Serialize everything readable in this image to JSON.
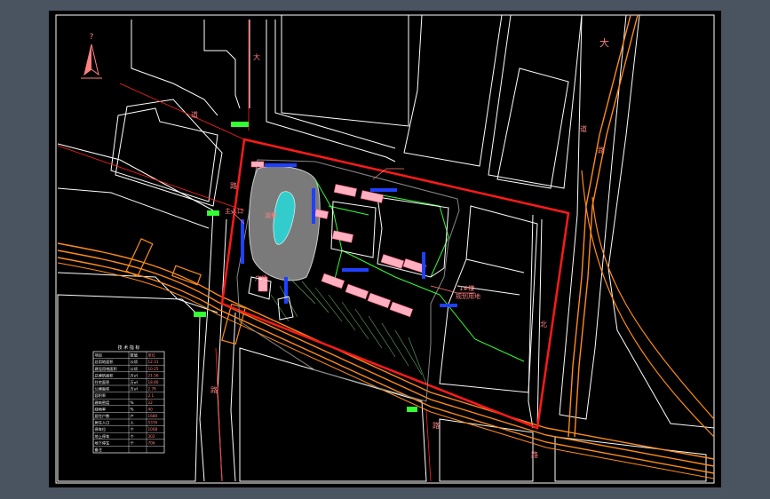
{
  "drawing": {
    "north_mark": "?",
    "road_labels": {
      "top_road": "大",
      "right_road_upper": "道",
      "right_road_lower": "路",
      "vertical_road": "大",
      "site_mid_road": "北",
      "bottom_left": "路",
      "bottom_mid": "路",
      "bottom_right": "路",
      "left_road": "路",
      "left_top": "道"
    },
    "site_labels": {
      "lake_label": "湖景",
      "callout_right_1": "1#楼",
      "callout_right_2": "规划用地",
      "callout_left": "主入口",
      "plaza_label": "广场"
    },
    "legend": {
      "title": "技 术 指 标",
      "header": [
        "项目",
        "数值",
        "单位"
      ],
      "rows": [
        [
          "总用地面积",
          "公顷",
          "12.31"
        ],
        [
          "建设用地面积",
          "公顷",
          "10.25"
        ],
        [
          "总建筑面积",
          "万㎡",
          "21.56"
        ],
        [
          "住宅面积",
          "万㎡",
          "18.80"
        ],
        [
          "公建面积",
          "万㎡",
          "2.76"
        ],
        [
          "容积率",
          "",
          "2.1"
        ],
        [
          "建筑密度",
          "%",
          "22"
        ],
        [
          "绿地率",
          "%",
          "40"
        ],
        [
          "居住户数",
          "户",
          "1680"
        ],
        [
          "居住人口",
          "人",
          "5376"
        ],
        [
          "停车位",
          "个",
          "1008"
        ],
        [
          "地上停车",
          "个",
          "302"
        ],
        [
          "地下停车",
          "个",
          "706"
        ],
        [
          "备注",
          "",
          ""
        ]
      ]
    },
    "colors": {
      "background": "#000000",
      "frame": "#4a5360",
      "boundary": "#ff1a1a",
      "road": "#ff8c1a",
      "road_line": "#ffffff",
      "green": "#33ff33",
      "building": "#ffb0c0",
      "water": "#33cccc",
      "label": "#ff8080"
    }
  }
}
